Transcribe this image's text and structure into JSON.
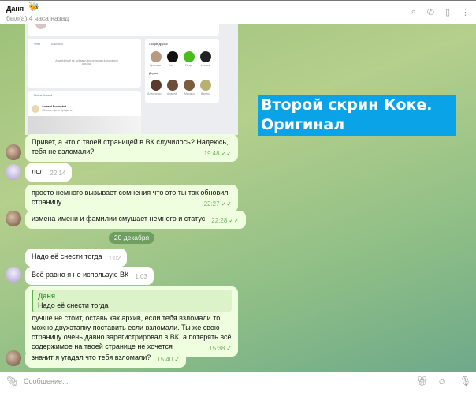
{
  "header": {
    "name": "Даня",
    "emoji": "🐝",
    "status": "был(а) 4 часа назад"
  },
  "vk": {
    "tab_photo": "Фото",
    "tab_albums": "Альбомы",
    "empty": "Arcaeld ещё не добавил фотографии в основной альбом",
    "mutual": "Общие друзья",
    "mutual_names": [
      "Ярослав",
      "Ева",
      "Пётр",
      "Никита"
    ],
    "friends": "Друзья",
    "friend_names": [
      "Александр",
      "Андрей",
      "Михаил",
      "Валера"
    ],
    "posts": "Посты Arcaeld",
    "author": "Arcaeld Brunestud",
    "action": "обновил фото профиля"
  },
  "messages": [
    {
      "text": "Привет, а что с твоей страницей в ВК случилось? Надеюсь, тебя не взломали?",
      "time": "19:48",
      "check": "✓✓"
    },
    {
      "text": "лол",
      "time": "22:14"
    },
    {
      "text": "просто немного вызывает сомнения что это ты так обновил страницу",
      "time": "22:27",
      "check": "✓✓"
    },
    {
      "text": "измена имени и фамилии смущает немного и статус",
      "time": "22:28",
      "check": "✓✓"
    },
    {
      "text": "Надо её снести тогда",
      "time": "1:02"
    },
    {
      "text": "Всё равно я не использую ВК",
      "time": "1:03"
    },
    {
      "reply_name": "Даня",
      "reply_text": "Надо её снести тогда",
      "text": "лучше не стоит, оставь как архив, если тебя взломали то можно двухэтапку поставить если взломали. Ты же свою страницу очень давно зарегистрировал в ВК, а потерять всё содержимое на твоей странице не хочется",
      "time": "15:38",
      "check": "✓"
    },
    {
      "text": "значит я угадал что тебя взломали?",
      "time": "15:40",
      "check": "✓"
    }
  ],
  "date_separator": "20 декабря",
  "overlay": {
    "line1": "Второй скрин Коке.",
    "line2": "Оригинал"
  },
  "composer": {
    "placeholder": "Сообщение..."
  }
}
